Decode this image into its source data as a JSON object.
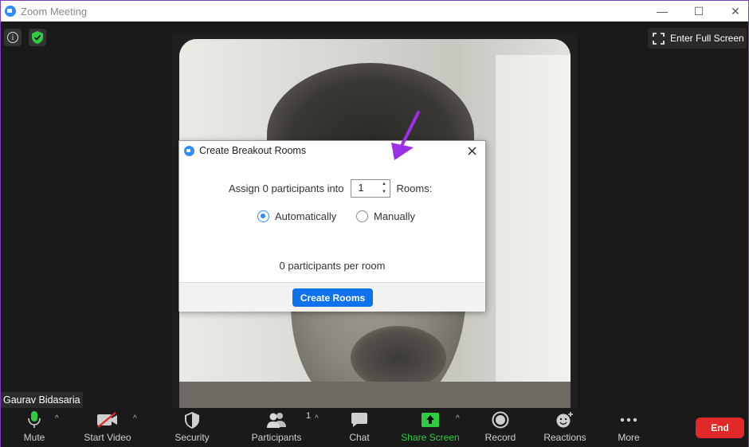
{
  "window": {
    "title": "Zoom Meeting",
    "controls": {
      "minimize": "—",
      "maximize": "☐",
      "close": "✕"
    }
  },
  "meeting": {
    "info_icon": "i",
    "fullscreen_label": "Enter Full Screen",
    "participant_name": "Gaurav Bidasaria"
  },
  "dialog": {
    "title": "Create Breakout Rooms",
    "assign_prefix": "Assign 0 participants into",
    "rooms_value": "1",
    "rooms_suffix": "Rooms:",
    "option_auto": "Automatically",
    "option_manual": "Manually",
    "selected_option": "Automatically",
    "per_room_text": "0 participants per room",
    "create_button": "Create Rooms"
  },
  "toolbar": {
    "mute": "Mute",
    "start_video": "Start Video",
    "security": "Security",
    "participants": "Participants",
    "participants_count": "1",
    "chat": "Chat",
    "share_screen": "Share Screen",
    "record": "Record",
    "reactions": "Reactions",
    "more": "More",
    "end": "End"
  },
  "colors": {
    "accent": "#2d8cff",
    "share_green": "#2ecc40",
    "end_red": "#e02828",
    "annotation_arrow": "#9b30e8"
  }
}
